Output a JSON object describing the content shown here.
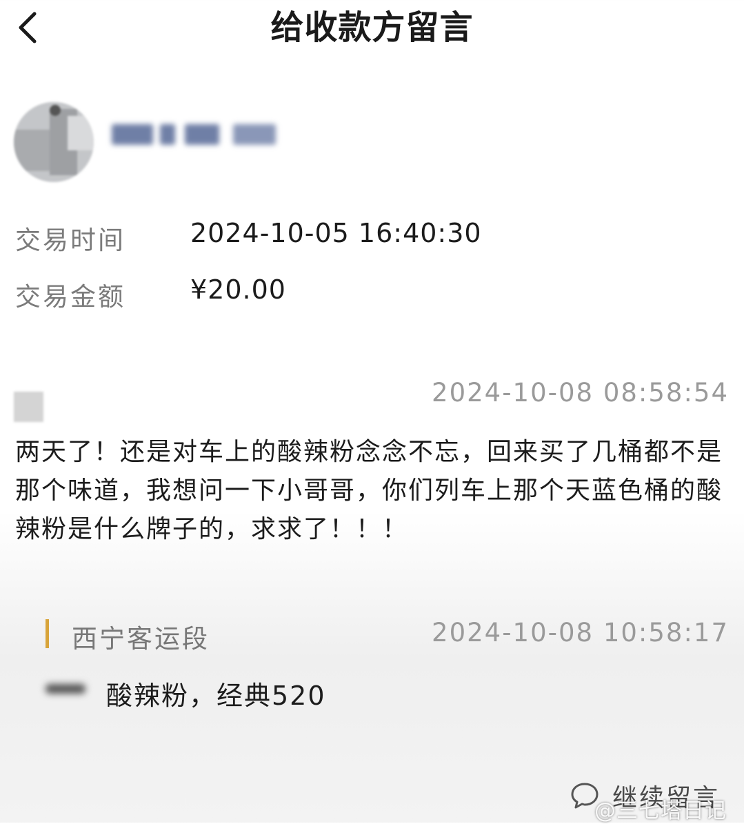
{
  "header": {
    "title": "给收款方留言",
    "back_icon": "chevron-left-icon"
  },
  "payer": {
    "avatar_icon": "avatar-blurred"
  },
  "transaction": {
    "time_label": "交易时间",
    "time_value": "2024-10-05 16:40:30",
    "amount_label": "交易金额",
    "amount_value": "¥20.00"
  },
  "message": {
    "timestamp": "2024-10-08 08:58:54",
    "text": "两天了！还是对车上的酸辣粉念念不忘，回来买了几桶都不是那个味道，我想问一下小哥哥，你们列车上那个天蓝色桶的酸辣粉是什么牌子的，求求了！！！"
  },
  "reply": {
    "sender": "西宁客运段",
    "timestamp": "2024-10-08 10:58:17",
    "text": "酸辣粉，经典520",
    "accent_color": "#d8a43a"
  },
  "footer": {
    "continue_label": "继续留言",
    "continue_icon": "speech-bubble-icon"
  },
  "watermark": {
    "text": "@三七塔日记"
  }
}
